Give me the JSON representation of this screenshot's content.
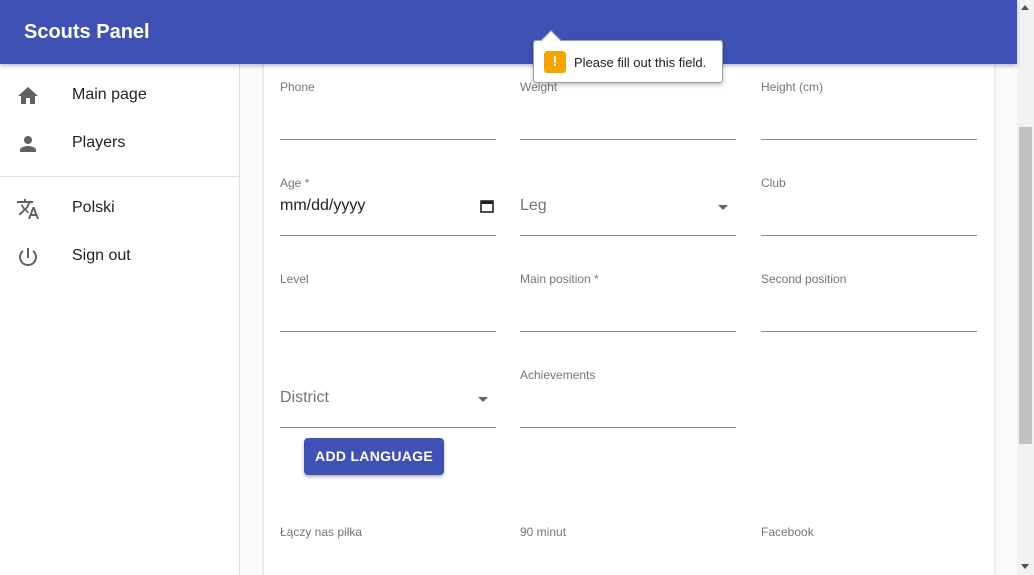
{
  "app": {
    "title": "Scouts Panel"
  },
  "nav": {
    "main_page": "Main page",
    "players": "Players",
    "language": "Polski",
    "sign_out": "Sign out"
  },
  "form": {
    "phone": {
      "label": "Phone",
      "value": ""
    },
    "weight": {
      "label": "Weight",
      "value": ""
    },
    "height": {
      "label": "Height (cm)",
      "value": ""
    },
    "age": {
      "label": "Age *",
      "value": "mm/dd/yyyy"
    },
    "leg": {
      "placeholder": "Leg"
    },
    "club": {
      "label": "Club",
      "value": ""
    },
    "level": {
      "label": "Level",
      "value": ""
    },
    "main_position": {
      "label": "Main position *",
      "value": ""
    },
    "second_position": {
      "label": "Second position",
      "value": ""
    },
    "district": {
      "placeholder": "District"
    },
    "achievements": {
      "label": "Achievements",
      "value": ""
    },
    "add_language_button": "ADD LANGUAGE",
    "laczy_nas_pilka": {
      "label": "Łączy nas piłka",
      "value": ""
    },
    "minut_90": {
      "label": "90 minut",
      "value": ""
    },
    "facebook": {
      "label": "Facebook",
      "value": ""
    }
  },
  "validation_tooltip": {
    "message": "Please fill out this field."
  },
  "colors": {
    "primary": "#3f51b5",
    "warning": "#f5a300"
  }
}
